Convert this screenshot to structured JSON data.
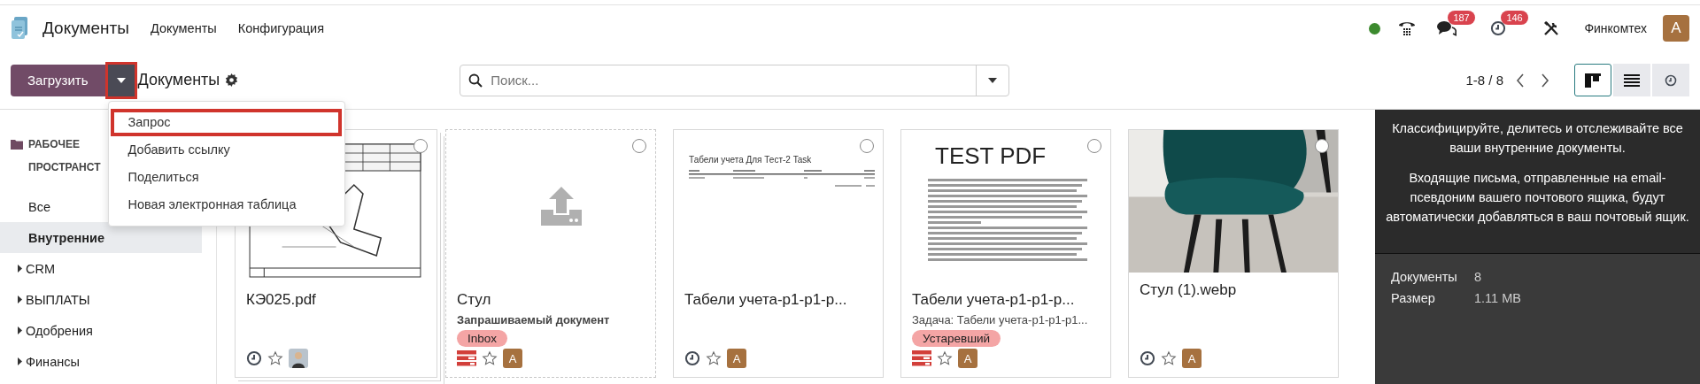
{
  "navbar": {
    "app_name": "Документы",
    "menu": [
      {
        "label": "Документы"
      },
      {
        "label": "Конфигурация"
      }
    ],
    "chat_badge": "187",
    "activity_badge": "146",
    "company": "Финкомтех",
    "user_initial": "A"
  },
  "control_panel": {
    "upload_button": "Загрузить",
    "toggle_highlighted": true,
    "breadcrumb": "Документы",
    "search": {
      "placeholder": "Поиск..."
    },
    "pager": "1-8 / 8",
    "views": [
      {
        "kind": "kanban",
        "selected": true
      },
      {
        "kind": "list",
        "selected": false
      },
      {
        "kind": "activity",
        "selected": false
      }
    ]
  },
  "upload_menu": {
    "items": [
      {
        "label": "Запрос",
        "highlighted": true
      },
      {
        "label": "Добавить ссылку",
        "highlighted": false
      },
      {
        "label": "Поделиться",
        "highlighted": false
      },
      {
        "label": "Новая электронная таблица",
        "highlighted": false
      }
    ]
  },
  "sidebar": {
    "title": "РАБОЧЕЕ ПРОСТРАНСТ",
    "items": [
      {
        "label": "Все",
        "selected": false,
        "expandable": false
      },
      {
        "label": "Внутренние",
        "selected": true,
        "expandable": false
      },
      {
        "label": "CRM",
        "selected": false,
        "expandable": true
      },
      {
        "label": "ВЫПЛАТЫ",
        "selected": false,
        "expandable": true
      },
      {
        "label": "Одобрения",
        "selected": false,
        "expandable": true
      },
      {
        "label": "Финансы",
        "selected": false,
        "expandable": true
      }
    ]
  },
  "cards": [
    {
      "kind": "stack",
      "preview": {
        "kind": "drawing"
      },
      "name": "КЭ025.pdf",
      "selected": false,
      "activity": {
        "kind": "clock"
      },
      "starred": false
    },
    {
      "kind": "request",
      "preview": {
        "kind": "upload"
      },
      "name": "Стул",
      "subtitle": "Запрашиваемый документ",
      "subtitle_bold": true,
      "tag": "Inbox",
      "selected": false,
      "activity": {
        "kind": "overdue"
      },
      "starred": false,
      "avatar": {
        "kind": "letter",
        "text": "A"
      }
    },
    {
      "kind": "single",
      "preview": {
        "kind": "table_doc",
        "heading": "Табели учета Для Тест-2 Task"
      },
      "name": "Табели учета-p1-p1-p...",
      "selected": false,
      "activity": {
        "kind": "clock"
      },
      "starred": false,
      "avatar": {
        "kind": "letter",
        "text": "A"
      }
    },
    {
      "kind": "single",
      "preview": {
        "kind": "text_doc",
        "heading": "TEST PDF"
      },
      "name": "Табели учета-p1-p1-p...",
      "subtitle": "Задача: Табели учета-p1-p1-p1...",
      "subtitle_bold": false,
      "tag": "Устаревший",
      "selected": false,
      "activity": {
        "kind": "overdue"
      },
      "starred": false,
      "avatar": {
        "kind": "letter",
        "text": "A"
      }
    },
    {
      "kind": "single",
      "name": "Стул (1).webp",
      "selected": false,
      "activity": {
        "kind": "clock"
      },
      "starred": false,
      "avatar": {
        "kind": "letter",
        "text": "A"
      }
    }
  ],
  "info_panel": {
    "paragraphs": [
      "Классифицируйте, делитесь и отслеживайте все ваши внутренние документы.",
      "Входящие письма, отправленные на email-псевдоним вашего почтового ящика, будут автоматически добавляться в ваш почтовый ящик."
    ],
    "stats": [
      {
        "label": "Документы",
        "value": "8"
      },
      {
        "label": "Размер",
        "value": "1.11 MB"
      }
    ]
  }
}
